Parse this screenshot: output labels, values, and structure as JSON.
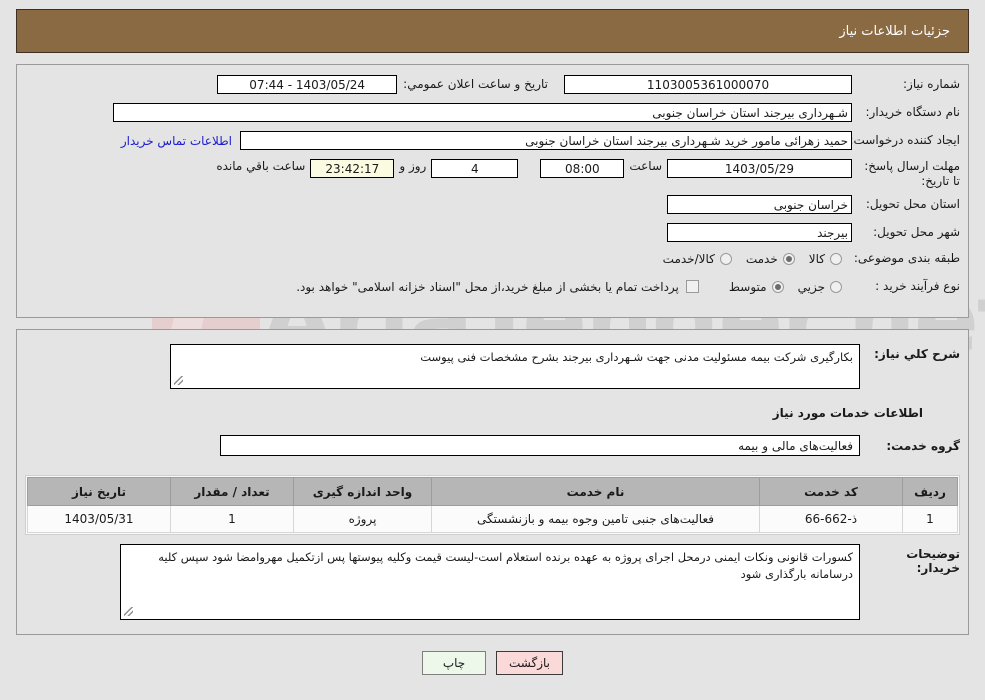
{
  "header": {
    "title": "جزئیات اطلاعات نیاز"
  },
  "form": {
    "labels": {
      "need_number": "شماره نیاز:",
      "buyer_org": "نام دستگاه خریدار:",
      "requester": "ایجاد کننده درخواست:",
      "deadline": "مهلت ارسال پاسخ: تا تاریخ:",
      "province": "استان محل تحویل:",
      "city": "شهر محل تحویل:",
      "classification": "طبقه بندی موضوعی:",
      "process_type": "نوع فرآیند خرید :",
      "announce_datetime": "تاریخ و ساعت اعلان عمومي:",
      "hour": "ساعت",
      "days_and": "روز و",
      "hours_left": "ساعت باقي مانده"
    },
    "values": {
      "need_number": "1103005361000070",
      "buyer_org": "شـهرداری بیرجند استان خراسان جنوبی",
      "requester": "حمید زهرائی مامور خرید شـهرداری بیرجند استان خراسان جنوبی",
      "deadline_date": "1403/05/29",
      "deadline_time": "08:00",
      "days_left": "4",
      "time_left": "23:42:17",
      "province": "خراسان جنوبی",
      "city": "بیرجند",
      "announce_datetime": "1403/05/24 - 07:44"
    },
    "contact_link": "اطلاعات تماس خریدار",
    "classification_options": [
      {
        "label": "کالا",
        "selected": false
      },
      {
        "label": "خدمت",
        "selected": true
      },
      {
        "label": "کالا/خدمت",
        "selected": false
      }
    ],
    "process_options": [
      {
        "label": "جزیي",
        "selected": false
      },
      {
        "label": "متوسط",
        "selected": true
      }
    ],
    "treasury_checkbox": {
      "checked": false,
      "label": "پرداخت تمام یا بخشی از مبلغ خرید،از محل \"اسناد خزانه اسلامی\" خواهد بود."
    }
  },
  "details": {
    "need_description_label": "شرح کلي نیاز:",
    "need_description": "بکارگیری شرکت بیمه مسئولیت مدنی جهت شـهرداری بیرجند بشرح مشخصات فنی پیوست",
    "services_section_title": "اطلاعات خدمات مورد نیاز",
    "service_group_label": "گروه خدمت:",
    "service_group": "فعالیت‌های مالی و بیمه",
    "buyer_notes_label": "توضیحات خریدار:",
    "buyer_notes": "کسورات قانونی ونکات ایمنی درمحل اجرای پروژه به عهده برنده استعلام است-لیست قیمت وکلیه پیوستها پس ازتکمیل مهروامضا شود سپس کلیه درسامانه بارگذاری شود"
  },
  "table": {
    "columns": [
      "ردیف",
      "کد خدمت",
      "نام خدمت",
      "واحد اندازه گیری",
      "تعداد / مقدار",
      "تاریخ نیاز"
    ],
    "rows": [
      {
        "row": "1",
        "code": "ذ-662-66",
        "name": "فعالیت‌های جنبی تامین وجوه بیمه و بازنشستگی",
        "unit": "پروژه",
        "quantity": "1",
        "need_date": "1403/05/31"
      }
    ]
  },
  "buttons": {
    "back": "بازگشت",
    "print": "چاپ"
  },
  "watermark": {
    "text": "AriaTender.net"
  },
  "colors": {
    "header_bg": "#8a6a42",
    "page_bg": "#e4e4e4",
    "link": "#1b1bcf",
    "highlight_field": "#fbfbe2",
    "back_button": "#fbd9d9",
    "print_button": "#edf8ea",
    "table_header": "#b6b6b6"
  }
}
